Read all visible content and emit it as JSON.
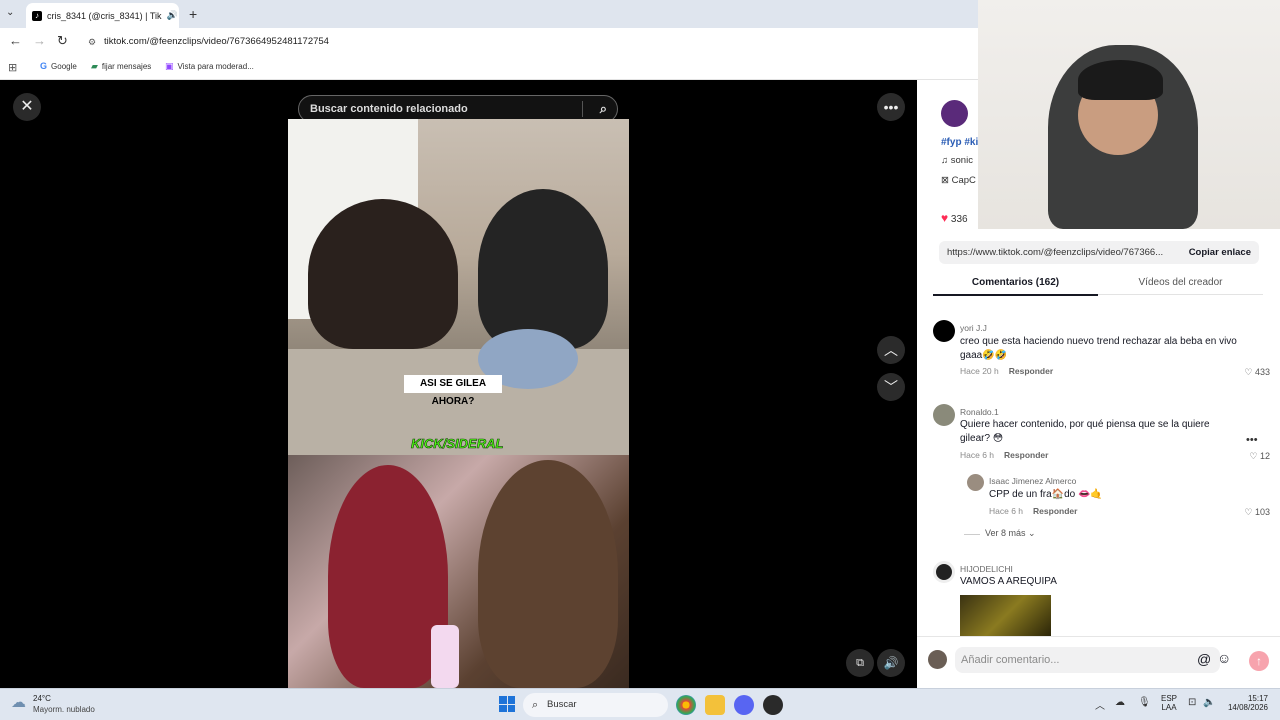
{
  "browser": {
    "tab_title": "cris_8341 (@cris_8341) | Tik",
    "url": "tiktok.com/@feenzclips/video/7673664952481172754",
    "bookmarks": [
      "Google",
      "fijar mensajes",
      "Vista para moderad..."
    ]
  },
  "player": {
    "search_placeholder": "Buscar contenido relacionado",
    "caption": "ASI SE GILEA AHORA?",
    "watermark": "KICK/SIDERAL"
  },
  "sidebar": {
    "partial_tags": "#fyp #ki",
    "partial_music": "sonic",
    "partial_effect": "CapC",
    "partial_likes": "336",
    "link": "https://www.tiktok.com/@feenzclips/video/767366...",
    "copy_link": "Copiar enlace",
    "tabs": [
      "Comentarios (162)",
      "Vídeos del creador"
    ],
    "reply_label": "Responder",
    "more_replies": "Ver 8 más",
    "comment_placeholder": "Añadir comentario...",
    "comments": [
      {
        "user": "yori J.J",
        "text": "creo que esta haciendo nuevo trend rechazar ala beba en vivo gaaa🤣🤣",
        "time": "Hace 20 h",
        "likes": "433"
      },
      {
        "user": "Ronaldo.1",
        "text": "Quiere hacer contenido, por qué piensa que se la quiere gilear? 😳",
        "time": "Hace 6 h",
        "likes": "12"
      },
      {
        "user": "Isaac Jimenez Almerco",
        "text": "CPP de un fra🏠do 👄🤙",
        "time": "Hace 6 h",
        "likes": "103"
      },
      {
        "user": "HIJODELICHI",
        "text": "VAMOS A AREQUIPA"
      }
    ]
  },
  "taskbar": {
    "weather_temp": "24°C",
    "weather_desc": "Mayorm. nublado",
    "search": "Buscar",
    "lang1": "ESP",
    "lang2": "LAA",
    "time": "15:17",
    "date": "14/08/2026"
  }
}
